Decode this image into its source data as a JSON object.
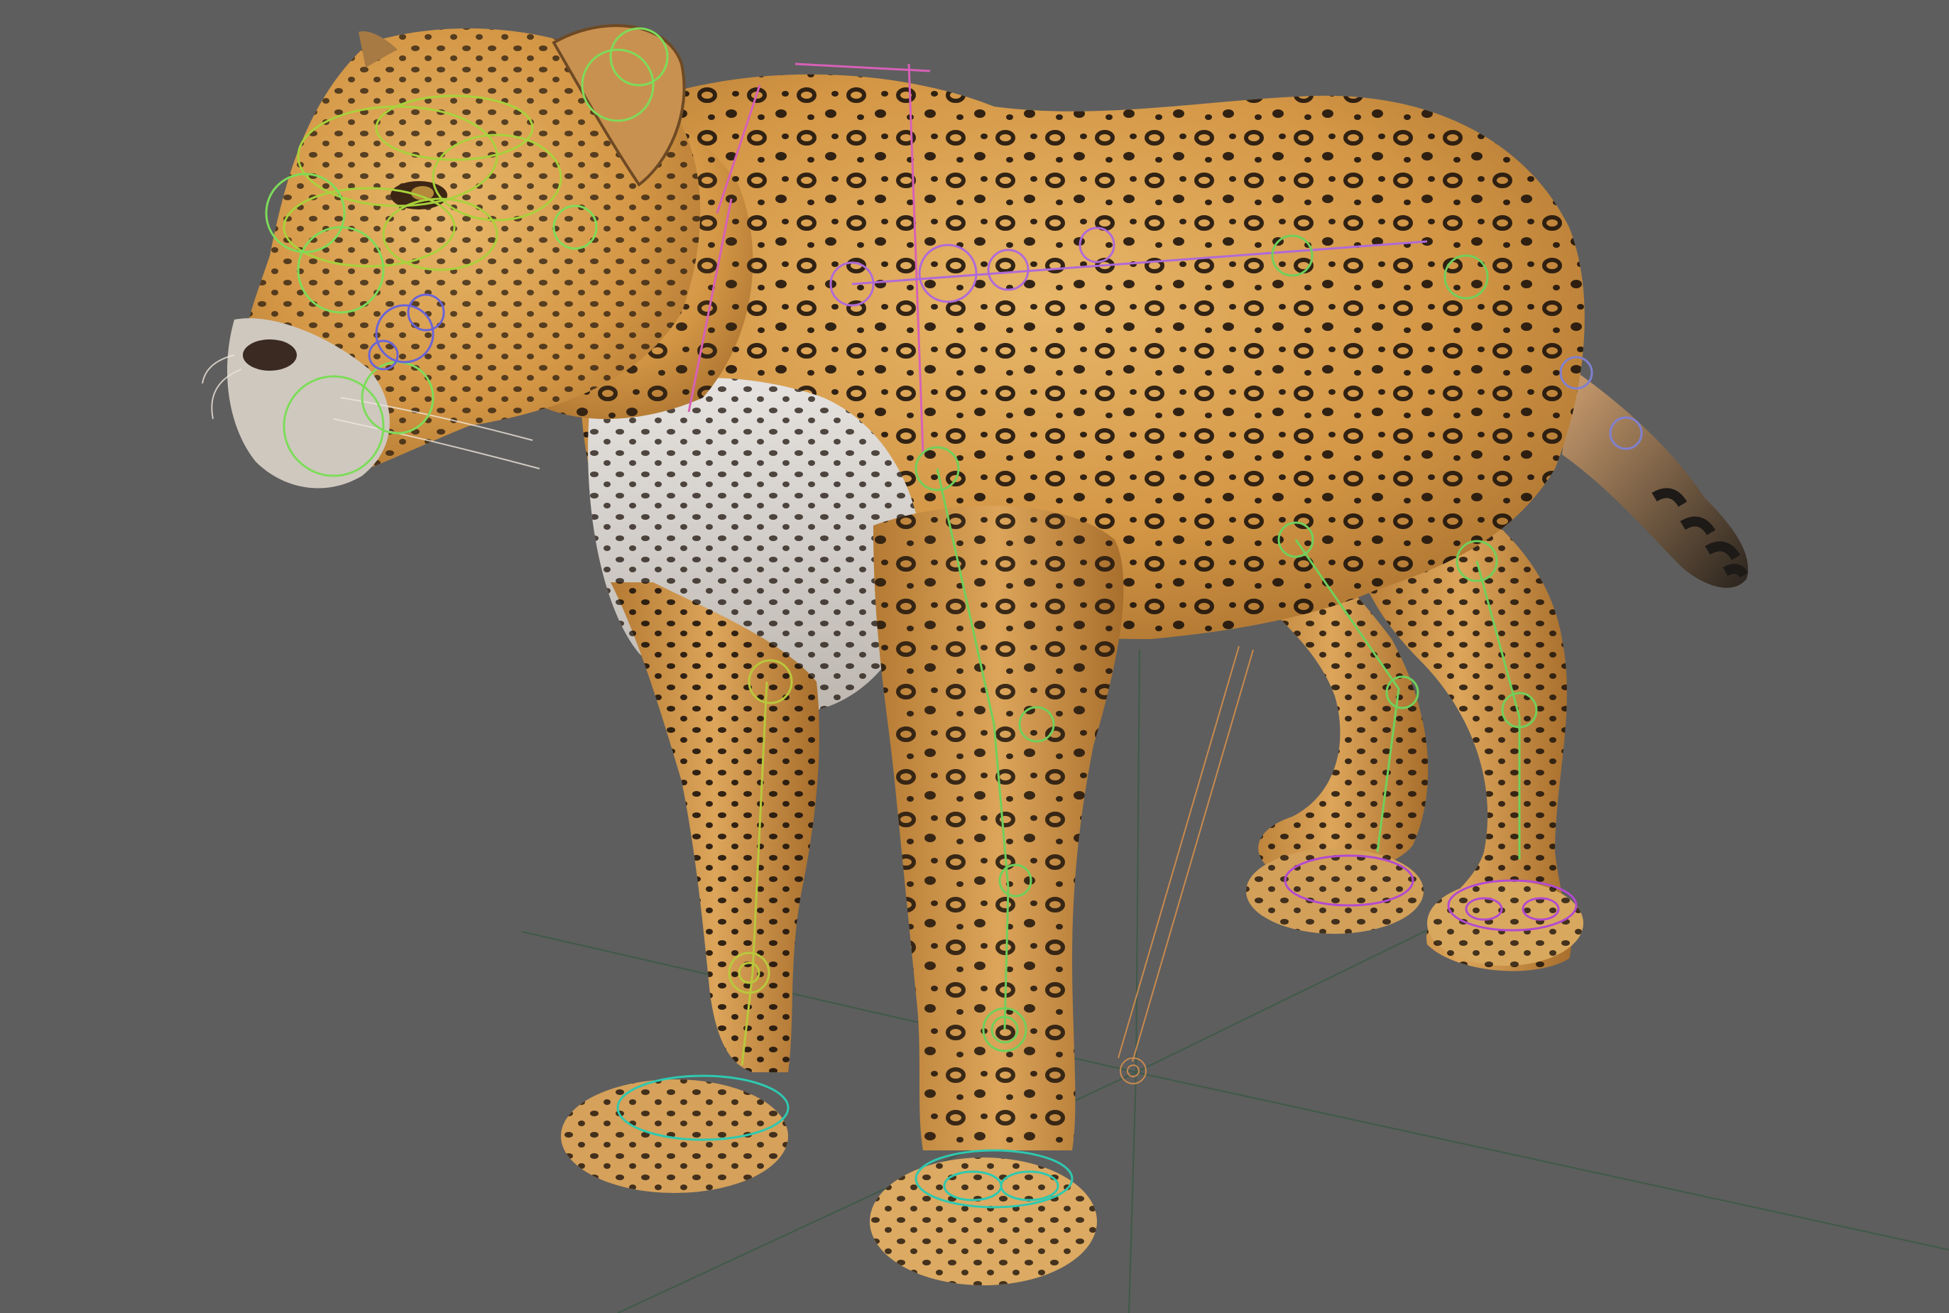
{
  "viewport": {
    "background_color": "#5e5e5e",
    "ground_grid_color": "#3f5a48",
    "pivot_color": "#c98a4e"
  },
  "subject": {
    "fur_base_color": "#d49a4c",
    "fur_light_color": "#e7b86c",
    "belly_color": "#d9d6d3",
    "spot_color": "#1e140c"
  },
  "rig": {
    "control_colors": {
      "head": "#a8d23c",
      "face": "#7ddc5a",
      "mouth": "#6a64d8",
      "spine": "#b06ad8",
      "neck": "#d860b8",
      "leg_controls": "#6fd05c",
      "paw_controls": "#2ec9b0",
      "hind_paw_controls": "#b34ad0",
      "tail": "#8080d0"
    }
  }
}
